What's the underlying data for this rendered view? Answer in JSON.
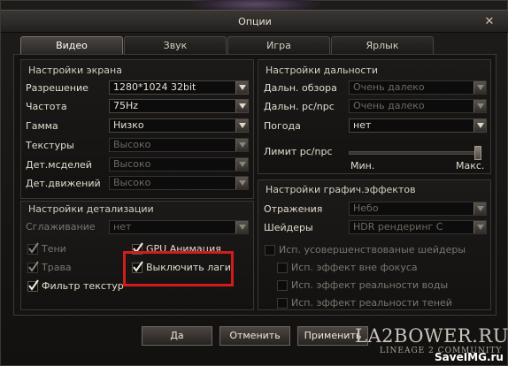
{
  "window": {
    "title": "Опции",
    "close_symbol": "✕"
  },
  "tabs": [
    {
      "label": "Видео",
      "active": true
    },
    {
      "label": "Звук",
      "active": false
    },
    {
      "label": "Игра",
      "active": false
    },
    {
      "label": "Ярлык",
      "active": false
    }
  ],
  "screen_settings": {
    "title": "Настройки экрана",
    "rows": [
      {
        "label": "Разрешение",
        "value": "1280*1024 32bit",
        "enabled": true
      },
      {
        "label": "Частота",
        "value": "75Hz",
        "enabled": true
      },
      {
        "label": "Гамма",
        "value": "Низко",
        "enabled": true
      },
      {
        "label": "Текстуры",
        "value": "Высоко",
        "enabled": false
      },
      {
        "label": "Дет.мсделей",
        "value": "Высоко",
        "enabled": false
      },
      {
        "label": "Дет.движений",
        "value": "Высоко",
        "enabled": false
      }
    ]
  },
  "detail_settings": {
    "title": "Настройки детализации",
    "smoothing": {
      "label": "Сглаживание",
      "value": "нет"
    },
    "checkboxes": [
      {
        "label": "Тени",
        "checked": true,
        "enabled": false
      },
      {
        "label": "GPU Анимация",
        "checked": true,
        "enabled": true
      },
      {
        "label": "Трава",
        "checked": true,
        "enabled": false
      },
      {
        "label": "Выключить лаги",
        "checked": true,
        "enabled": true
      },
      {
        "label": "Фильтр текстур",
        "checked": true,
        "enabled": true
      }
    ]
  },
  "distance_settings": {
    "title": "Настройки дальности",
    "rows": [
      {
        "label": "Дальн. обзора",
        "value": "Очень далеко",
        "enabled": false
      },
      {
        "label": "Дальн. pc/npc",
        "value": "Очень далеко",
        "enabled": false
      },
      {
        "label": "Погода",
        "value": "нет",
        "enabled": true
      }
    ],
    "limit": {
      "label": "Лимит pc/npc",
      "min_label": "Мин.",
      "max_label": "Макс.",
      "value_fraction": 1.0
    }
  },
  "effects_settings": {
    "title": "Настройки графич.эффектов",
    "rows": [
      {
        "label": "Отражения",
        "value": "Небо",
        "enabled": false
      },
      {
        "label": "Шейдеры",
        "value": "HDR рендеринг С",
        "enabled": false
      }
    ],
    "checkboxes": [
      {
        "label": "Исп. усовершенствованые шейдеры",
        "checked": false
      },
      {
        "label": "Исп. эффект вне фокуса",
        "checked": false
      },
      {
        "label": "Исп. эффект реальности воды",
        "checked": false
      },
      {
        "label": "Исп. эффект реальности теней",
        "checked": false
      }
    ]
  },
  "buttons": {
    "ok": "Да",
    "cancel": "Отменить",
    "apply": "Применить"
  },
  "watermarks": {
    "site": "LA2BOWER.RU",
    "subtitle": "LINEAGE 2 COMMUNITY",
    "host": "SaveIMG.ru"
  },
  "colors": {
    "highlight": "#d21c1c",
    "accent": "#e8e2d4"
  }
}
